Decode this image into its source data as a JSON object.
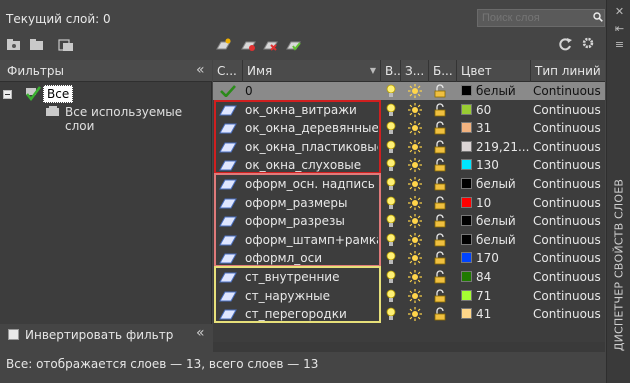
{
  "header": {
    "current_layer": "Текущий слой: 0",
    "search_placeholder": "Поиск слоя"
  },
  "sidebar_title": "ДИСПЕТЧЕР СВОЙСТВ СЛОЕВ",
  "filters": {
    "title": "Фильтры",
    "root_label": "Все",
    "used_label": "Все используемые слои",
    "invert_label": "Инвертировать фильтр"
  },
  "columns": {
    "status": "С...",
    "name": "Имя",
    "on": "В...",
    "freeze": "З...",
    "lock": "Б...",
    "color": "Цвет",
    "linetype": "Тип линий"
  },
  "layers": [
    {
      "name": "0",
      "color_name": "белый",
      "color": "#000000",
      "linetype": "Continuous",
      "current": true
    },
    {
      "name": "ок_окна_витражи",
      "color_name": "60",
      "color": "#99cc33",
      "linetype": "Continuous"
    },
    {
      "name": "ок_окна_деревянные",
      "color_name": "31",
      "color": "#f2b380",
      "linetype": "Continuous"
    },
    {
      "name": "ок_окна_пластиковые",
      "color_name": "219,21...",
      "color": "#dbd5d5",
      "linetype": "Continuous"
    },
    {
      "name": "ок_окна_слуховые",
      "color_name": "130",
      "color": "#00e5ff",
      "linetype": "Continuous"
    },
    {
      "name": "оформ_осн. надпись",
      "color_name": "белый",
      "color": "#000000",
      "linetype": "Continuous"
    },
    {
      "name": "оформ_размеры",
      "color_name": "10",
      "color": "#ff0000",
      "linetype": "Continuous"
    },
    {
      "name": "оформ_разрезы",
      "color_name": "белый",
      "color": "#000000",
      "linetype": "Continuous"
    },
    {
      "name": "оформ_штамп+рамка",
      "color_name": "белый",
      "color": "#000000",
      "linetype": "Continuous"
    },
    {
      "name": "оформл_оси",
      "color_name": "170",
      "color": "#0044ff",
      "linetype": "Continuous"
    },
    {
      "name": "ст_внутренние",
      "color_name": "84",
      "color": "#1f7a00",
      "linetype": "Continuous"
    },
    {
      "name": "ст_наружные",
      "color_name": "71",
      "color": "#a6ff33",
      "linetype": "Continuous"
    },
    {
      "name": "ст_перегородки",
      "color_name": "41",
      "color": "#ffd78a",
      "linetype": "Continuous"
    }
  ],
  "group_colors": [
    "#d01f1f",
    "#e07a7a",
    "#e7e07a"
  ],
  "status_bar": "Все: отображается слоев — 13, всего слоев — 13"
}
